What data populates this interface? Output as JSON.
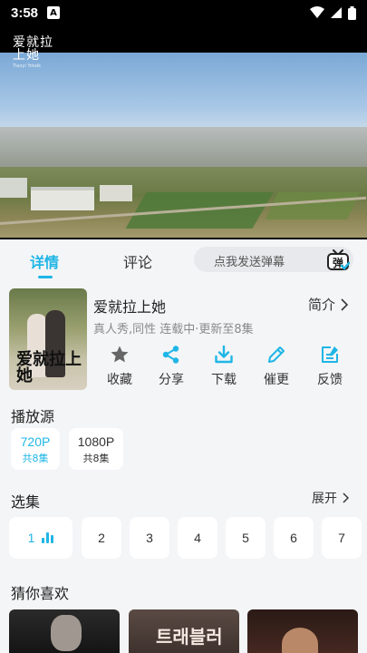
{
  "status_bar": {
    "time": "3:58",
    "notification": "A"
  },
  "video": {
    "logo_title": "爱就拉上她",
    "logo_sub": "Tiaoyi Yotalk"
  },
  "tabs": {
    "detail": "详情",
    "comment": "评论"
  },
  "danmu": {
    "placeholder": "点我发送弹幕",
    "icon_char": "弹"
  },
  "show": {
    "title": "爱就拉上她",
    "intro_label": "简介",
    "meta": "真人秀,同性 连载中·更新至8集",
    "cover_text": "爱就拉上她"
  },
  "actions": [
    {
      "label": "收藏",
      "icon": "star-icon"
    },
    {
      "label": "分享",
      "icon": "share-icon"
    },
    {
      "label": "下载",
      "icon": "download-icon"
    },
    {
      "label": "催更",
      "icon": "pen-icon"
    },
    {
      "label": "反馈",
      "icon": "feedback-icon"
    }
  ],
  "sources": {
    "title": "播放源",
    "items": [
      {
        "resolution": "720P",
        "episodes": "共8集",
        "active": true
      },
      {
        "resolution": "1080P",
        "episodes": "共8集",
        "active": false
      }
    ]
  },
  "episodes": {
    "title": "选集",
    "expand_label": "展开",
    "items": [
      "1",
      "2",
      "3",
      "4",
      "5",
      "6",
      "7"
    ],
    "active_index": 0
  },
  "recommend": {
    "title": "猜你喜欢",
    "items": [
      {
        "text": ""
      },
      {
        "text": "트래블러"
      },
      {
        "text": ""
      }
    ]
  },
  "colors": {
    "accent": "#1fb6e6",
    "background": "#f4f5f7"
  }
}
